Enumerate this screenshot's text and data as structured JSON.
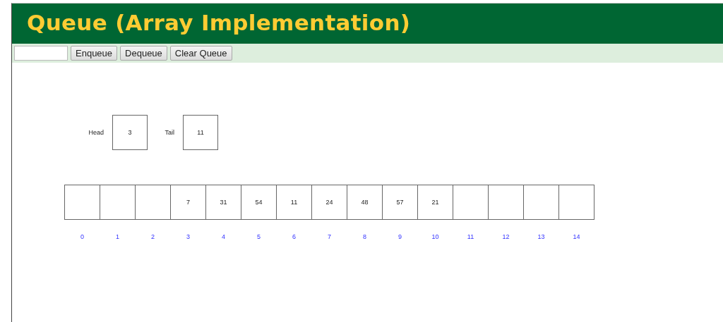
{
  "title": "Queue (Array Implementation)",
  "toolbar": {
    "buttons": [
      "Enqueue",
      "Dequeue",
      "Clear Queue"
    ]
  },
  "pointers": [
    {
      "label": "Head",
      "value": "3"
    },
    {
      "label": "Tail",
      "value": "11"
    }
  ],
  "array": [
    {
      "index": "0"
    },
    {
      "index": "1"
    },
    {
      "index": "2"
    },
    {
      "index": "3",
      "value": "7"
    },
    {
      "index": "4",
      "value": "31"
    },
    {
      "index": "5",
      "value": "54"
    },
    {
      "index": "6",
      "value": "11"
    },
    {
      "index": "7",
      "value": "24"
    },
    {
      "index": "8",
      "value": "48"
    },
    {
      "index": "9",
      "value": "57"
    },
    {
      "index": "10",
      "value": "21"
    },
    {
      "index": "11"
    },
    {
      "index": "12"
    },
    {
      "index": "13"
    },
    {
      "index": "14"
    }
  ]
}
